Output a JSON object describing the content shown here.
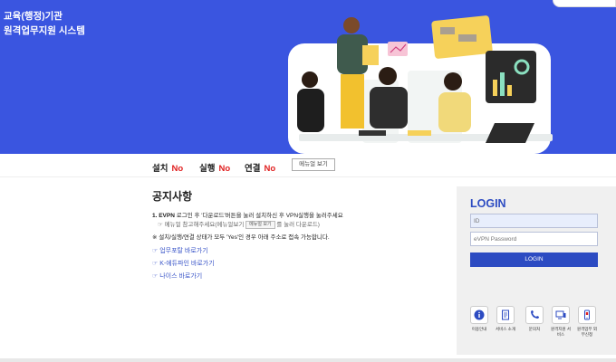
{
  "header": {
    "org_title": "교육(행정)기관",
    "system_title": "원격업무지원 시스템"
  },
  "status": {
    "install_label": "설치",
    "install_value": "No",
    "run_label": "실행",
    "run_value": "No",
    "connect_label": "연결",
    "connect_value": "No",
    "manual_button": "메뉴얼 보기"
  },
  "notice": {
    "title": "공지사항",
    "line1_prefix": "1. EVPN ",
    "line1_text": "로그인 후 '다운로드'버튼을 눌러 설치하신 후 VPN실행을 눌러주세요",
    "line2_prefix": "☞ 메뉴얼 참고해주세요(메뉴얼보기 ",
    "line2_btn": "메뉴얼 보기",
    "line2_suffix": " 를 눌러 다운로드)",
    "line3": "※ 설치/실행/연결 상태가 모두 'Yes'인 경우 아래 주소로 접속 가능합니다.",
    "links": [
      "☞ 업무포탈 바로가기",
      "☞ K-에듀파인 바로가기",
      "☞ 나이스 바로가기"
    ]
  },
  "login": {
    "title": "LOGIN",
    "id_placeholder": "ID",
    "password_placeholder": "eVPN Password",
    "login_button": "LOGIN"
  },
  "services": [
    {
      "label": "이용안내",
      "icon": "info-icon"
    },
    {
      "label": "서비스 소개",
      "icon": "document-icon"
    },
    {
      "label": "문의처",
      "icon": "phone-icon"
    },
    {
      "label": "원격지원 서비스",
      "icon": "remote-support-icon"
    },
    {
      "label": "원격업무 외부신청",
      "icon": "mobile-apply-icon"
    }
  ],
  "colors": {
    "banner_bg": "#3a55e0",
    "accent": "#2c4bc2",
    "status_no": "#e02020"
  }
}
